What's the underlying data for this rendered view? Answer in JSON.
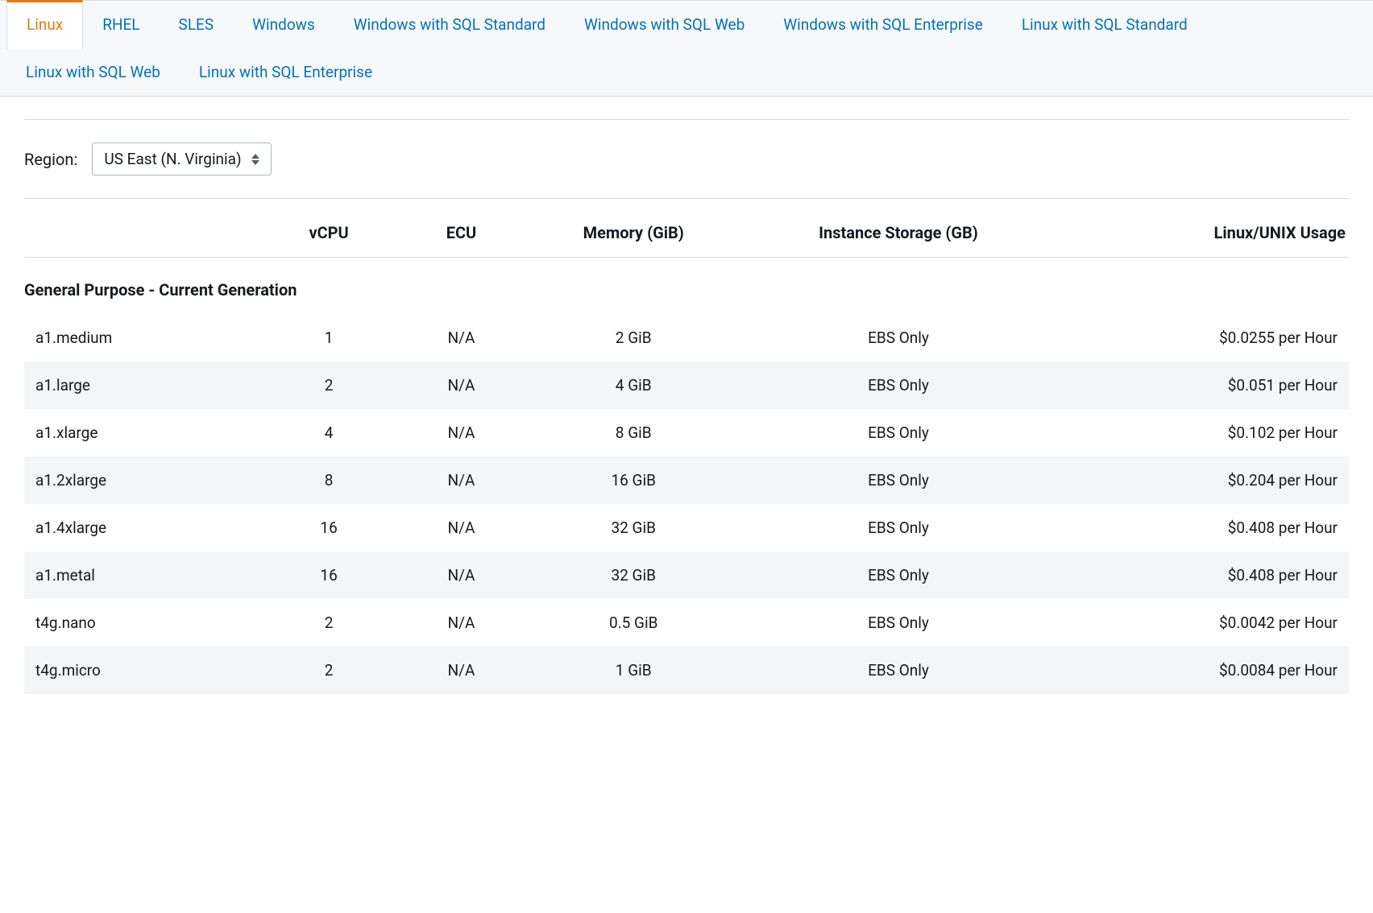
{
  "tabs": [
    {
      "label": "Linux",
      "active": true
    },
    {
      "label": "RHEL",
      "active": false
    },
    {
      "label": "SLES",
      "active": false
    },
    {
      "label": "Windows",
      "active": false
    },
    {
      "label": "Windows with SQL Standard",
      "active": false
    },
    {
      "label": "Windows with SQL Web",
      "active": false
    },
    {
      "label": "Windows with SQL Enterprise",
      "active": false
    },
    {
      "label": "Linux with SQL Standard",
      "active": false
    },
    {
      "label": "Linux with SQL Web",
      "active": false
    },
    {
      "label": "Linux with SQL Enterprise",
      "active": false
    }
  ],
  "region": {
    "label": "Region:",
    "selected": "US East (N. Virginia)"
  },
  "table": {
    "headers": [
      "",
      "vCPU",
      "ECU",
      "Memory (GiB)",
      "Instance Storage (GB)",
      "Linux/UNIX Usage"
    ],
    "section_title": "General Purpose - Current Generation",
    "rows": [
      {
        "name": "a1.medium",
        "vcpu": "1",
        "ecu": "N/A",
        "memory": "2 GiB",
        "storage": "EBS Only",
        "usage": "$0.0255 per Hour"
      },
      {
        "name": "a1.large",
        "vcpu": "2",
        "ecu": "N/A",
        "memory": "4 GiB",
        "storage": "EBS Only",
        "usage": "$0.051 per Hour"
      },
      {
        "name": "a1.xlarge",
        "vcpu": "4",
        "ecu": "N/A",
        "memory": "8 GiB",
        "storage": "EBS Only",
        "usage": "$0.102 per Hour"
      },
      {
        "name": "a1.2xlarge",
        "vcpu": "8",
        "ecu": "N/A",
        "memory": "16 GiB",
        "storage": "EBS Only",
        "usage": "$0.204 per Hour"
      },
      {
        "name": "a1.4xlarge",
        "vcpu": "16",
        "ecu": "N/A",
        "memory": "32 GiB",
        "storage": "EBS Only",
        "usage": "$0.408 per Hour"
      },
      {
        "name": "a1.metal",
        "vcpu": "16",
        "ecu": "N/A",
        "memory": "32 GiB",
        "storage": "EBS Only",
        "usage": "$0.408 per Hour"
      },
      {
        "name": "t4g.nano",
        "vcpu": "2",
        "ecu": "N/A",
        "memory": "0.5 GiB",
        "storage": "EBS Only",
        "usage": "$0.0042 per Hour"
      },
      {
        "name": "t4g.micro",
        "vcpu": "2",
        "ecu": "N/A",
        "memory": "1 GiB",
        "storage": "EBS Only",
        "usage": "$0.0084 per Hour"
      }
    ]
  }
}
